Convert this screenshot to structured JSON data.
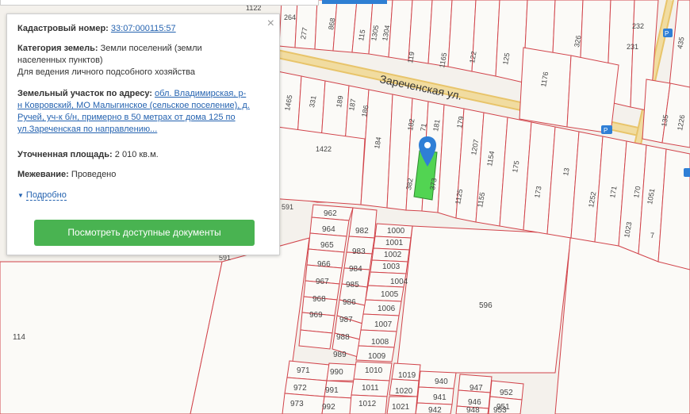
{
  "popup": {
    "close_icon": "×",
    "cadastral_number_label": "Кадастровый номер:",
    "cadastral_number_value": "33:07:000115:57",
    "land_category_label": "Категория земель:",
    "land_category_value_line1": "Земли поселений (земли",
    "land_category_value_line2": "населенных пунктов)",
    "permitted_use": "Для ведения личного подсобного хозяйства",
    "address_label": "Земельный участок по адресу:",
    "address_line1": "обл. Владимирская, р-",
    "address_line2": "н Ковровский, МО Малыгинское (сельское поселение), д.",
    "address_line3": "Ручей, уч-к б/н, примерно в 50 метрах от дома 125 по",
    "address_line4": "ул.Зареченская по направлению...",
    "area_label": "Уточненная площадь:",
    "area_value": "2 010 кв.м.",
    "survey_label": "Межевание:",
    "survey_value": "Проведено",
    "more_link": "Подробно",
    "docs_button": "Посмотреть доступные документы"
  },
  "map": {
    "street_name": "Зареченская ул.",
    "selected_parcel_color": "#52d452",
    "border_color": "#d1434a",
    "road_color": "#f1dca0",
    "marker_color": "#2f7fd6",
    "road_badge": "Р",
    "labels": {
      "l_264": "264",
      "l_868": "868",
      "l_1122": "1122",
      "l_277": "277",
      "l_1165": "1165",
      "l_1304": "1304",
      "l_1305": "1305",
      "l_115": "115",
      "l_119": "119",
      "l_122": "122",
      "l_125": "125",
      "l_1176": "1176",
      "l_326": "326",
      "l_232": "232",
      "l_231": "231",
      "l_435": "435",
      "l_1465": "1465",
      "l_331": "331",
      "l_189": "189",
      "l_187": "187",
      "l_186": "186",
      "l_182": "182",
      "l_181": "181",
      "l_179": "179",
      "l_1207": "1207",
      "l_1422": "1422",
      "l_184": "184",
      "l_382": "382",
      "l_373": "373",
      "l_1125": "1125",
      "l_1155": "1155",
      "l_1154": "1154",
      "l_175": "175",
      "l_173": "173",
      "l_1252": "1252",
      "l_171": "171",
      "l_170": "170",
      "l_1051": "1051",
      "l_135": "135",
      "l_1226": "1226",
      "l_591a": "591",
      "l_591b": "591",
      "l_962": "962",
      "l_964": "964",
      "l_982": "982",
      "l_1000": "1000",
      "l_1001": "1001",
      "l_965": "965",
      "l_983": "983",
      "l_1002": "1002",
      "l_966": "966",
      "l_984": "984",
      "l_1003": "1003",
      "l_967": "967",
      "l_985": "985",
      "l_1004": "1004",
      "l_968": "968",
      "l_986": "986",
      "l_1005": "1005",
      "l_969": "969",
      "l_987": "987",
      "l_1006": "1006",
      "l_1007": "1007",
      "l_988": "988",
      "l_1008": "1008",
      "l_989": "989",
      "l_1009": "1009",
      "l_971": "971",
      "l_990": "990",
      "l_1010": "1010",
      "l_1019": "1019",
      "l_940": "940",
      "l_947": "947",
      "l_952": "952",
      "l_972": "972",
      "l_991": "991",
      "l_1011": "1011",
      "l_1020": "1020",
      "l_941": "941",
      "l_946": "946",
      "l_951": "951",
      "l_973": "973",
      "l_992": "992",
      "l_1012": "1012",
      "l_1021": "1021",
      "l_942": "942",
      "l_948": "948",
      "l_953": "953",
      "l_596": "596",
      "l_114": "114",
      "l_1023": "1023",
      "l_7": "7",
      "l_13": "13",
      "l_71": "71"
    }
  }
}
